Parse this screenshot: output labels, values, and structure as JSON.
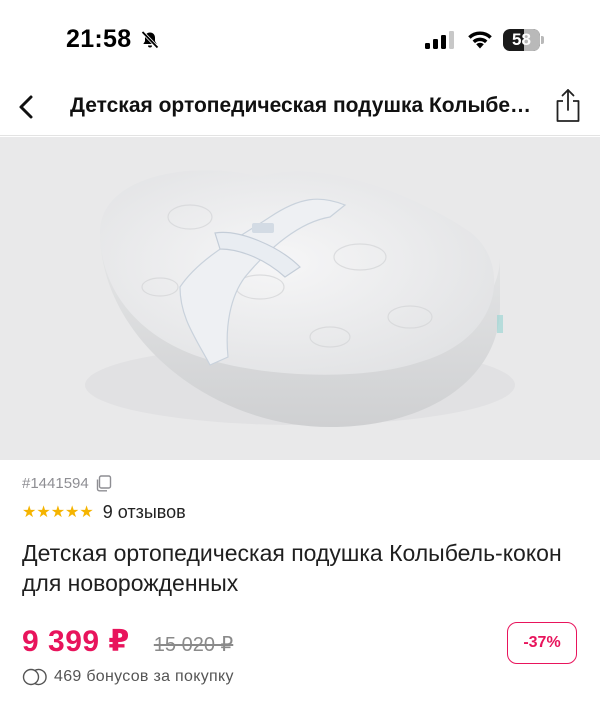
{
  "status_bar": {
    "time": "21:58",
    "battery_level": "58"
  },
  "nav": {
    "title": "Детская ортопедическая подушка Колыбель-кокон для новорожденных"
  },
  "product": {
    "image_alt": "pillow-product-photo",
    "sku": "#1441594",
    "rating_stars": "★★★★★",
    "rating_value": 5,
    "reviews": "9 отзывов",
    "title": "Детская ортопедическая подушка Колыбель-кокон для новорожденных",
    "price": "9 399 ₽",
    "old_price": "15 020 ₽",
    "discount": "-37%",
    "bonus": "469 бонусов за покупку"
  },
  "colors": {
    "accent": "#e8145c",
    "star": "#f5b400",
    "image_background": "#e9e9ea"
  }
}
